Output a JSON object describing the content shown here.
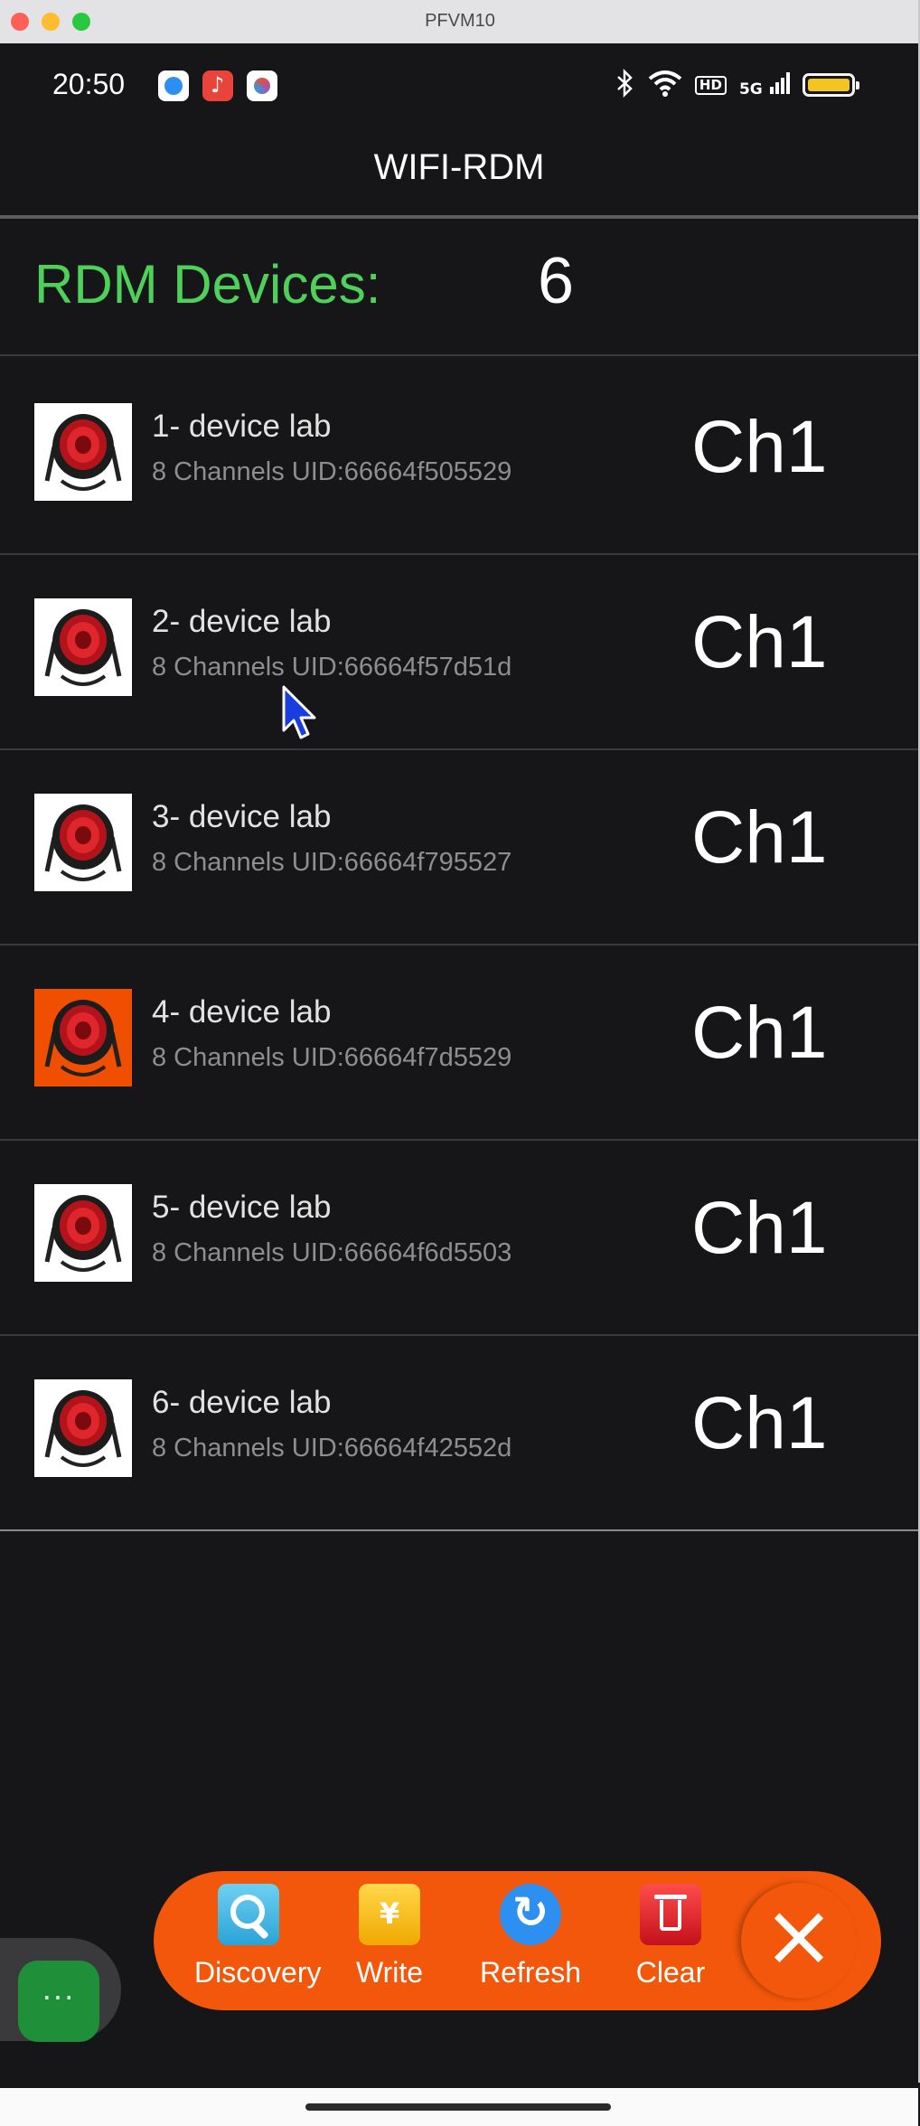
{
  "window": {
    "title": "PFVM10"
  },
  "status_bar": {
    "time": "20:50",
    "notification_icons": [
      "browser-icon",
      "music-icon",
      "photos-icon"
    ],
    "system_icons": [
      "bluetooth-icon",
      "wifi-icon",
      "hd-icon",
      "5g-signal-icon",
      "battery-icon"
    ],
    "hd_label": "HD",
    "network_label": "5G"
  },
  "app_bar": {
    "title": "WIFI-RDM"
  },
  "summary": {
    "label": "RDM Devices:",
    "count": "6"
  },
  "devices": [
    {
      "name": "1- device lab",
      "info": "8 Channels UID:66664f505529",
      "channel": "Ch1",
      "thumb": "white"
    },
    {
      "name": "2- device lab",
      "info": "8 Channels UID:66664f57d51d",
      "channel": "Ch1",
      "thumb": "white"
    },
    {
      "name": "3- device lab",
      "info": "8 Channels UID:66664f795527",
      "channel": "Ch1",
      "thumb": "white"
    },
    {
      "name": "4- device lab",
      "info": "8 Channels UID:66664f7d5529",
      "channel": "Ch1",
      "thumb": "orange"
    },
    {
      "name": "5- device lab",
      "info": "8 Channels UID:66664f6d5503",
      "channel": "Ch1",
      "thumb": "white"
    },
    {
      "name": "6- device lab",
      "info": "8 Channels UID:66664f42552d",
      "channel": "Ch1",
      "thumb": "white"
    }
  ],
  "toolbar": {
    "discovery": "Discovery",
    "write": "Write",
    "refresh": "Refresh",
    "clear": "Clear"
  },
  "colors": {
    "accent_orange": "#f2570b",
    "count_label_green": "#4ed05a",
    "background": "#161618"
  }
}
